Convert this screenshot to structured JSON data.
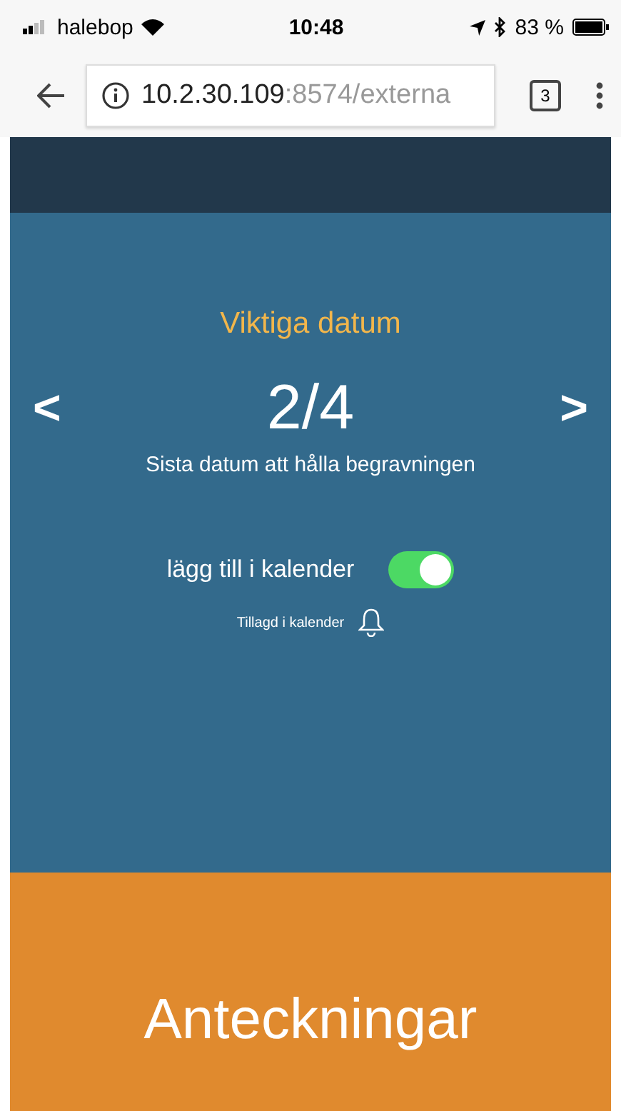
{
  "status_bar": {
    "carrier": "halebop",
    "time": "10:48",
    "battery": "83 %"
  },
  "browser": {
    "url_host": "10.2.30.109",
    "url_rest": ":8574/externa",
    "tab_count": "3"
  },
  "slide": {
    "title": "Viktiga datum",
    "counter": "2/4",
    "description": "Sista datum att hålla begravningen",
    "prev": "<",
    "next": ">"
  },
  "calendar_toggle": {
    "label": "lägg till i kalender",
    "on": true,
    "status": "Tillagd i kalender"
  },
  "notes": {
    "title": "Anteckningar"
  }
}
